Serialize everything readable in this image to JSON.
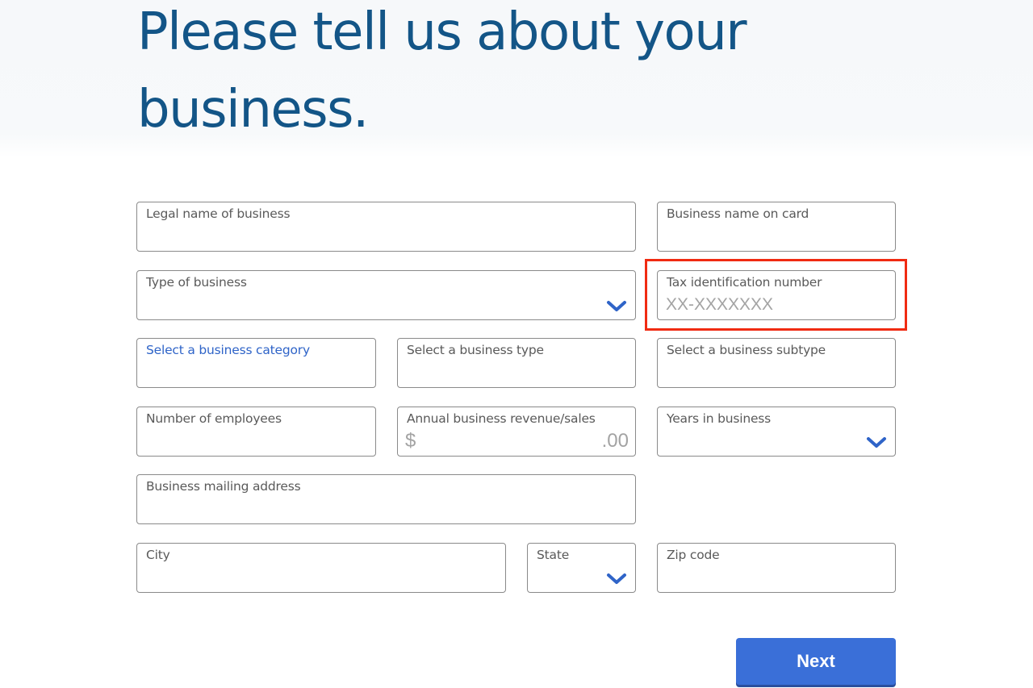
{
  "header": {
    "title": "Please tell us about your business."
  },
  "form": {
    "legal_name": {
      "label": "Legal name of business",
      "value": ""
    },
    "name_on_card": {
      "label": "Business name on card",
      "value": ""
    },
    "type_of_business": {
      "label": "Type of business",
      "value": "",
      "icon": "chevron-down-icon"
    },
    "tax_id": {
      "label": "Tax identification number",
      "placeholder": "XX-XXXXXXX",
      "value": ""
    },
    "business_category": {
      "label": "Select a business category",
      "value": ""
    },
    "business_type": {
      "label": "Select a business type",
      "value": ""
    },
    "business_subtype": {
      "label": "Select a business subtype",
      "value": ""
    },
    "employees": {
      "label": "Number of employees",
      "value": ""
    },
    "annual_revenue": {
      "label": "Annual business revenue/sales",
      "prefix": "$",
      "suffix": ".00",
      "value": ""
    },
    "years_in_business": {
      "label": "Years in business",
      "value": "",
      "icon": "chevron-down-icon"
    },
    "mailing_address": {
      "label": "Business mailing address",
      "value": ""
    },
    "city": {
      "label": "City",
      "value": ""
    },
    "state": {
      "label": "State",
      "value": "",
      "icon": "chevron-down-icon"
    },
    "zip_code": {
      "label": "Zip code",
      "value": ""
    }
  },
  "actions": {
    "next_label": "Next"
  },
  "colors": {
    "title": "#135587",
    "active_label": "#2f64c8",
    "chevron": "#2f64c8",
    "button": "#3a6fd8",
    "highlight": "#f02b12"
  }
}
